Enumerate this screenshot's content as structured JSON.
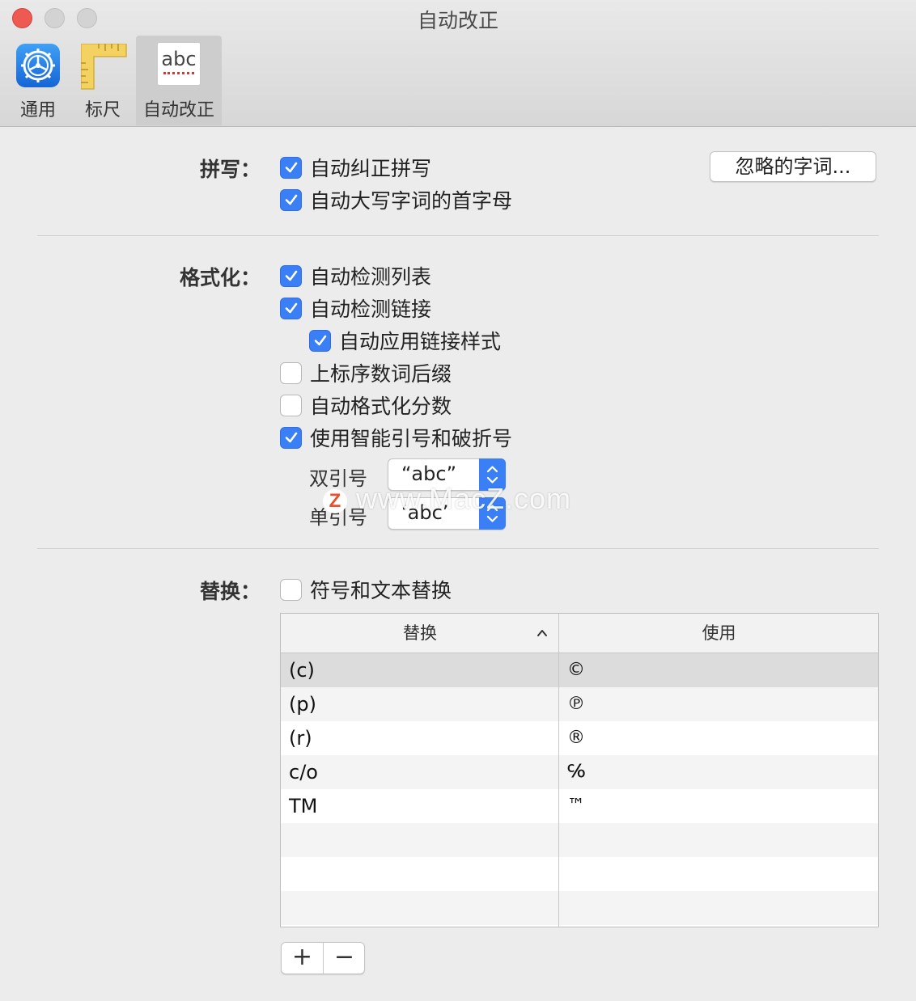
{
  "window": {
    "title": "自动改正"
  },
  "toolbar": {
    "items": [
      {
        "label": "通用",
        "icon": "gear-icon"
      },
      {
        "label": "标尺",
        "icon": "ruler-icon"
      },
      {
        "label": "自动改正",
        "icon": "abc-spellcheck-icon",
        "active": true,
        "icon_text": "abc"
      }
    ]
  },
  "spelling": {
    "label": "拼写：",
    "options": [
      {
        "label": "自动纠正拼写",
        "checked": true
      },
      {
        "label": "自动大写字词的首字母",
        "checked": true
      }
    ],
    "ignored_words_button": "忽略的字词..."
  },
  "formatting": {
    "label": "格式化：",
    "options": [
      {
        "label": "自动检测列表",
        "checked": true
      },
      {
        "label": "自动检测链接",
        "checked": true
      },
      {
        "label": "自动应用链接样式",
        "checked": true
      },
      {
        "label": "上标序数词后缀",
        "checked": false
      },
      {
        "label": "自动格式化分数",
        "checked": false
      },
      {
        "label": "使用智能引号和破折号",
        "checked": true
      }
    ],
    "double_quotes": {
      "label": "双引号",
      "value": "“abc”"
    },
    "single_quotes": {
      "label": "单引号",
      "value": "‘abc’"
    }
  },
  "replacement": {
    "label": "替换：",
    "option": {
      "label": "符号和文本替换",
      "checked": false
    },
    "table": {
      "headers": {
        "replace": "替换",
        "with": "使用"
      },
      "rows": [
        {
          "replace": "(c)",
          "with": "©",
          "selected": true
        },
        {
          "replace": "(p)",
          "with": "℗"
        },
        {
          "replace": "(r)",
          "with": "®"
        },
        {
          "replace": "c/o",
          "with": "℅"
        },
        {
          "replace": "TM",
          "with": "™"
        }
      ]
    },
    "add_button": "+",
    "remove_button": "−"
  },
  "watermark": {
    "text": "www.MacZ.com",
    "logo_letter": "Z"
  },
  "colors": {
    "accent": "#3a7ff6",
    "close": "#ee5a52"
  }
}
